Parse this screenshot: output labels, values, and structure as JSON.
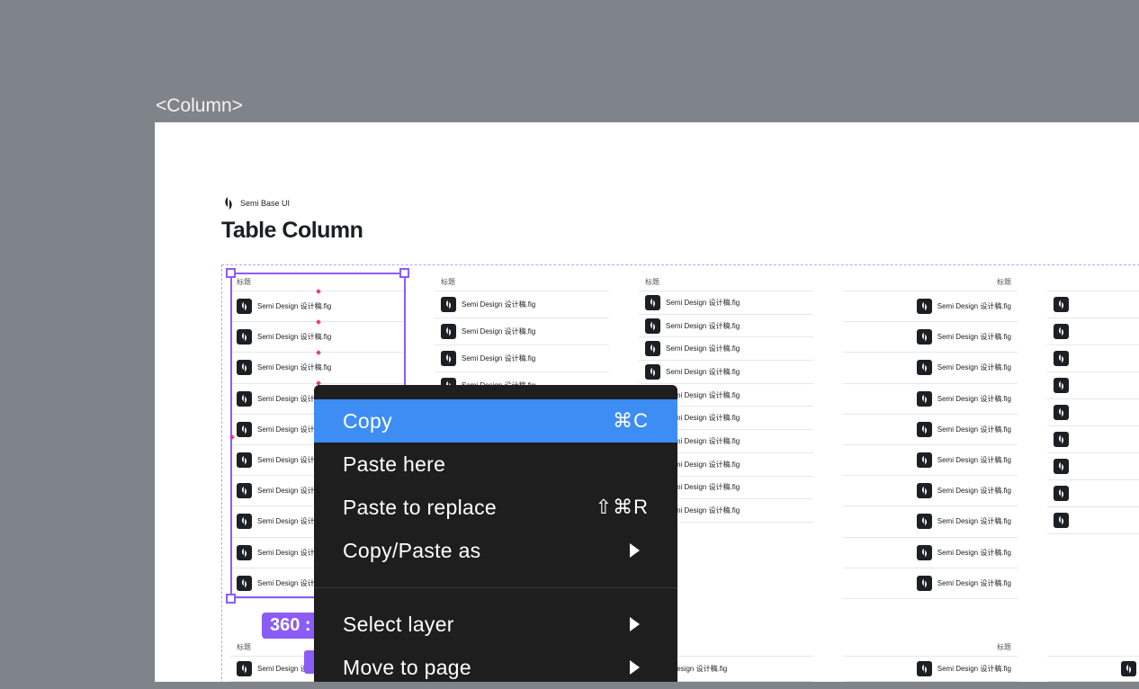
{
  "canvas": {
    "frame_label": "<Column>"
  },
  "header": {
    "brand": "Semi Base UI",
    "title": "Table Column"
  },
  "table": {
    "header_label": "标题",
    "file_name": "Semi Design 设计稿.fig",
    "file_name_truncated": "Semi Design 设计",
    "file_name_cut": "Semi Design 设计稿",
    "file_name_cut_left": "ni Design 设计稿.fig"
  },
  "selection": {
    "size_label": "360 :"
  },
  "context_menu": {
    "items": [
      {
        "label": "Copy",
        "shortcut": "⌘C",
        "active": true
      },
      {
        "label": "Paste here",
        "shortcut": ""
      },
      {
        "label": "Paste to replace",
        "shortcut": "⇧⌘R"
      },
      {
        "label": "Copy/Paste as",
        "submenu": true
      },
      {
        "label": "Select layer",
        "submenu": true
      },
      {
        "label": "Move to page",
        "submenu": true
      }
    ]
  },
  "colors": {
    "canvas_bg": "#7f848b",
    "selection": "#8b5cf6",
    "menu_bg": "#1e1e1e",
    "menu_active": "#3d8df5"
  },
  "icons": {
    "file": "semi-logo-icon",
    "submenu": "chevron-right-icon"
  }
}
